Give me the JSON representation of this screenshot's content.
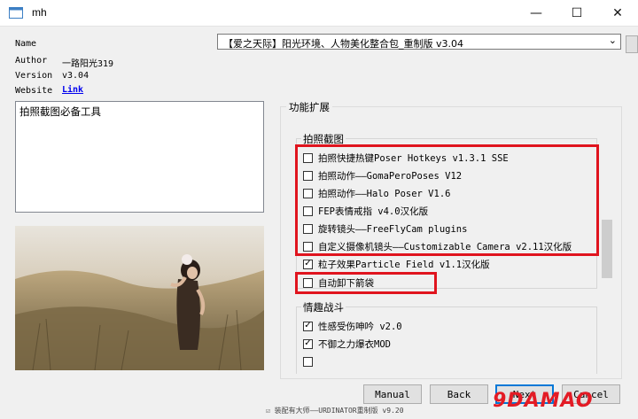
{
  "window": {
    "title": "mh",
    "minimize_glyph": "—",
    "maximize_glyph": "☐",
    "close_glyph": "✕"
  },
  "info": {
    "name_label": "Name",
    "author_label": "Author",
    "author_value": "一路阳光319",
    "version_label": "Version",
    "version_value": "v3.04",
    "website_label": "Website",
    "website_link": "Link"
  },
  "package_select": {
    "value": "【爱之天际】阳光环境、人物美化整合包_重制版 v3.04",
    "arrow": "⌄"
  },
  "description": "拍照截图必备工具",
  "features": {
    "title": "功能扩展",
    "groups": [
      {
        "title": "拍照截图",
        "items": [
          {
            "label": "拍照快捷热键Poser Hotkeys v1.3.1 SSE",
            "checked": false
          },
          {
            "label": "拍照动作——GomaPeroPoses V12",
            "checked": false
          },
          {
            "label": "拍照动作——Halo Poser V1.6",
            "checked": false
          },
          {
            "label": "FEP表情戒指 v4.0汉化版",
            "checked": false
          },
          {
            "label": "旋转镜头——FreeFlyCam plugins",
            "checked": false
          },
          {
            "label": "自定义摄像机镜头——Customizable Camera v2.11汉化版",
            "checked": false
          },
          {
            "label": "粒子效果Particle Field v1.1汉化版",
            "checked": true
          },
          {
            "label": "自动卸下箭袋",
            "checked": false
          }
        ]
      },
      {
        "title": "情趣战斗",
        "items": [
          {
            "label": "性感受伤呻吟 v2.0",
            "checked": true
          },
          {
            "label": "不御之力爆衣MOD",
            "checked": true
          }
        ]
      }
    ]
  },
  "buttons": {
    "manual": "Manual",
    "back": "Back",
    "next": "Next",
    "cancel": "Cancel"
  },
  "watermark": "9DAMAO",
  "bottom_strip_text": "☑ 装配有大师——URDINATOR重制版 v9.20",
  "colors": {
    "highlight_red": "#e0141e",
    "link_blue": "#0000ee",
    "default_button_border": "#0078d7"
  }
}
